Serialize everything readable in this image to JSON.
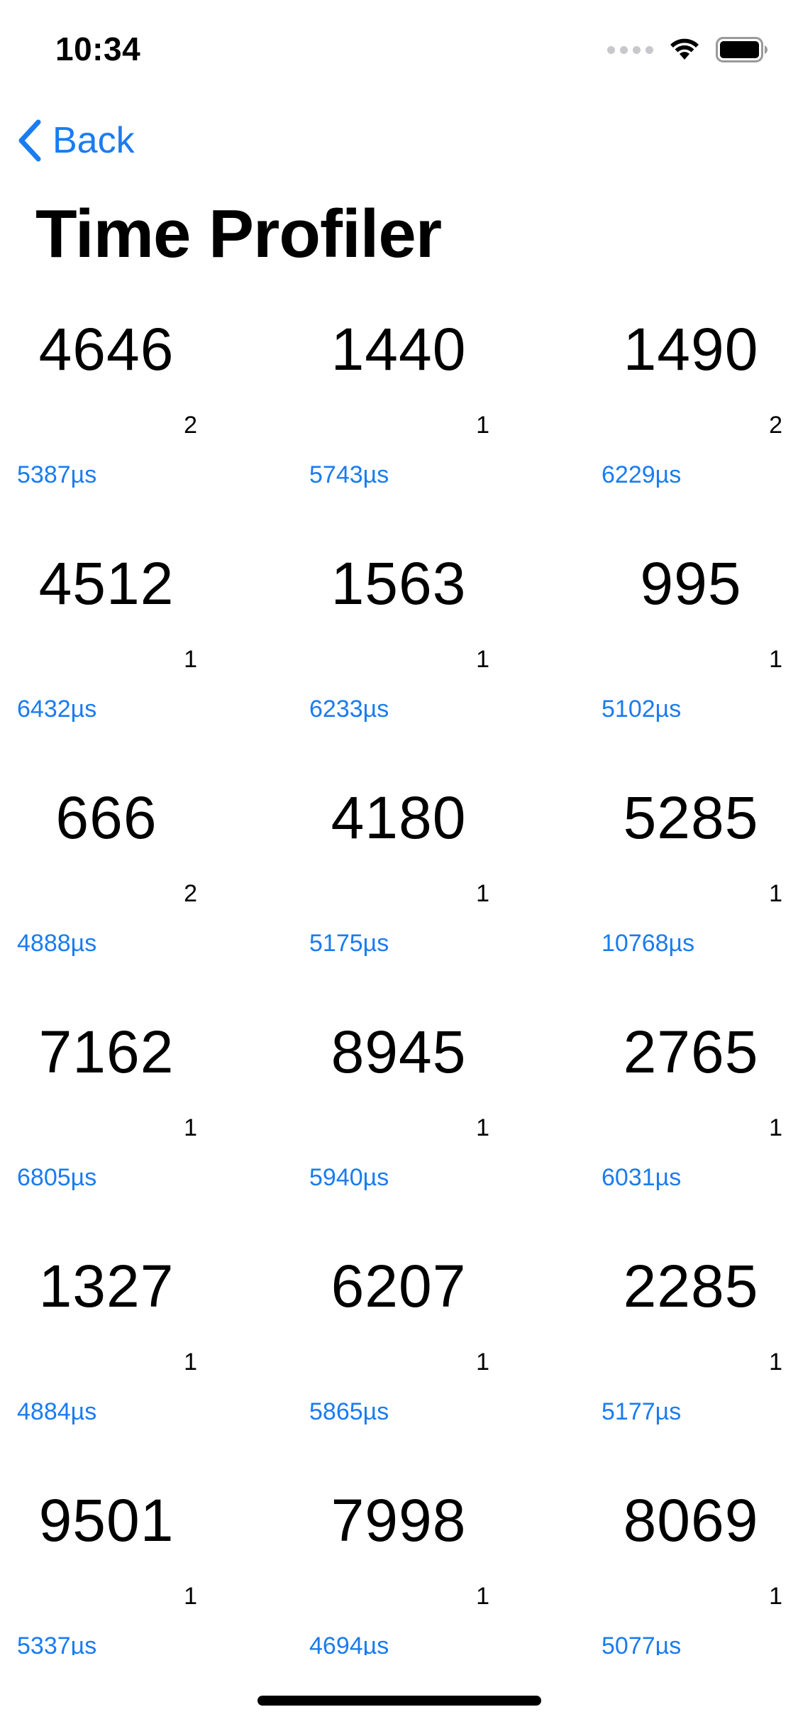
{
  "status_bar": {
    "time": "10:34"
  },
  "nav": {
    "back_label": "Back",
    "title": "Time Profiler"
  },
  "colors": {
    "accent": "#1a7cf0",
    "signal_inactive": "#c7c7cc"
  },
  "cells": [
    {
      "value": "4646",
      "count": "2",
      "duration": "5387µs"
    },
    {
      "value": "1440",
      "count": "1",
      "duration": "5743µs"
    },
    {
      "value": "1490",
      "count": "2",
      "duration": "6229µs"
    },
    {
      "value": "4512",
      "count": "1",
      "duration": "6432µs"
    },
    {
      "value": "1563",
      "count": "1",
      "duration": "6233µs"
    },
    {
      "value": "995",
      "count": "1",
      "duration": "5102µs"
    },
    {
      "value": "666",
      "count": "2",
      "duration": "4888µs"
    },
    {
      "value": "4180",
      "count": "1",
      "duration": "5175µs"
    },
    {
      "value": "5285",
      "count": "1",
      "duration": "10768µs"
    },
    {
      "value": "7162",
      "count": "1",
      "duration": "6805µs"
    },
    {
      "value": "8945",
      "count": "1",
      "duration": "5940µs"
    },
    {
      "value": "2765",
      "count": "1",
      "duration": "6031µs"
    },
    {
      "value": "1327",
      "count": "1",
      "duration": "4884µs"
    },
    {
      "value": "6207",
      "count": "1",
      "duration": "5865µs"
    },
    {
      "value": "2285",
      "count": "1",
      "duration": "5177µs"
    },
    {
      "value": "9501",
      "count": "1",
      "duration": "5337µs"
    },
    {
      "value": "7998",
      "count": "1",
      "duration": "4694µs"
    },
    {
      "value": "8069",
      "count": "1",
      "duration": "5077µs"
    }
  ]
}
